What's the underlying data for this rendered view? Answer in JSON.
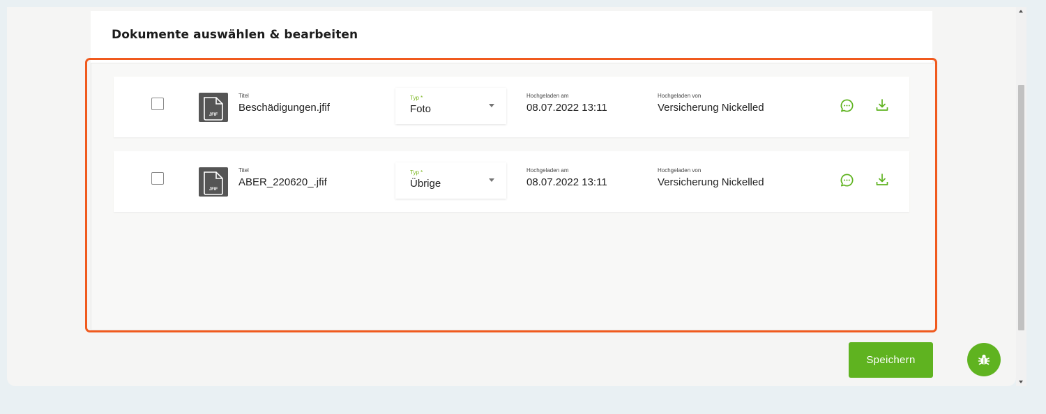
{
  "section": {
    "title": "Dokumente auswählen & bearbeiten"
  },
  "labels": {
    "title": "Titel",
    "type": "Typ *",
    "uploaded_at": "Hochgeladen am",
    "uploaded_by": "Hochgeladen von"
  },
  "documents": [
    {
      "file_badge": "JFIF",
      "title": "Beschädigungen.jfif",
      "type": "Foto",
      "uploaded_at": "08.07.2022 13:11",
      "uploaded_by": "Versicherung Nickelled"
    },
    {
      "file_badge": "JFIF",
      "title": "ABER_220620_.jfif",
      "type": "Übrige",
      "uploaded_at": "08.07.2022 13:11",
      "uploaded_by": "Versicherung Nickelled"
    }
  ],
  "actions": {
    "save_label": "Speichern"
  },
  "icons": {
    "comment": "comment-icon",
    "download": "download-icon",
    "bug": "bug-icon",
    "file": "file-icon"
  },
  "colors": {
    "accent_green": "#5fb320",
    "highlight_orange": "#f05a1e",
    "file_icon_gray": "#555555"
  }
}
